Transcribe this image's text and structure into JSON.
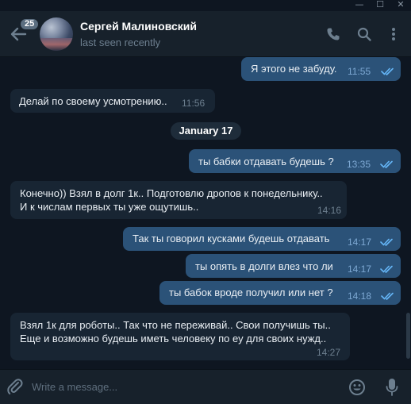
{
  "window": {
    "min_glyph": "—",
    "max_glyph": "☐",
    "close_glyph": "✕"
  },
  "header": {
    "unread_count": "25",
    "contact_name": "Сергей Малиновский",
    "status": "last seen recently",
    "icons": [
      "back-arrow-icon",
      "phone-icon",
      "search-icon",
      "more-vertical-icon"
    ]
  },
  "chat": {
    "date_separator": "January 17",
    "messages": [
      {
        "direction": "out",
        "text": "Я этого не забуду.",
        "time": "11:55",
        "read": true
      },
      {
        "direction": "in",
        "text": "Делай по своему усмотрению..",
        "time": "11:56"
      },
      {
        "direction": "out",
        "text": "ты бабки отдавать будешь ?",
        "time": "13:35",
        "read": true
      },
      {
        "direction": "in",
        "line1": "Конечно)) Взял в долг 1к.. Подготовлю дропов к понедельнику..",
        "line2": "И к числам первых ты уже ощутишь..",
        "time": "14:16"
      },
      {
        "direction": "out",
        "text": "Так ты говорил кусками будешь отдавать",
        "time": "14:17",
        "read": true
      },
      {
        "direction": "out",
        "text": "ты опять в долги влез что ли",
        "time": "14:17",
        "read": true
      },
      {
        "direction": "out",
        "text": "ты бабок вроде получил или нет ?",
        "time": "14:18",
        "read": true
      },
      {
        "direction": "in",
        "line1": "Взял 1к для роботы.. Так что не переживай.. Свои получишь ты..",
        "line2": "Еще и возможно будешь иметь человеку по еу для своих нужд..",
        "time": "14:27"
      }
    ]
  },
  "composer": {
    "placeholder": "Write a message...",
    "icons": [
      "paperclip-icon",
      "emoji-icon",
      "microphone-icon"
    ]
  },
  "colors": {
    "background": "#0e1621",
    "header": "#17212b",
    "incoming_bubble": "#182533",
    "outgoing_bubble": "#2b5278",
    "read_checks": "#64b5f6"
  }
}
